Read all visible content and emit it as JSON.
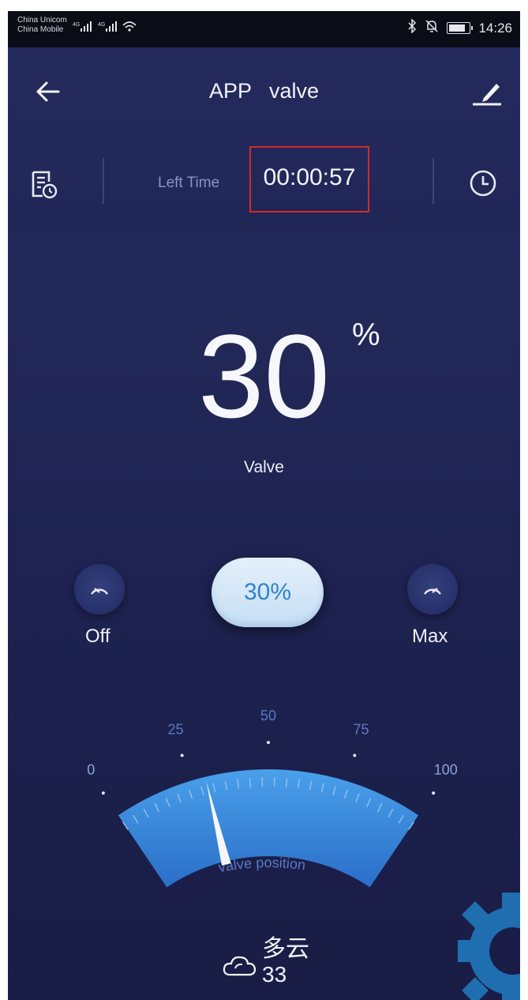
{
  "status_bar": {
    "carrier_1": "China Unicom",
    "carrier_2": "China Mobile",
    "network_1": "4G",
    "network_2": "4G",
    "time": "14:26",
    "battery_level": 0.7
  },
  "app_bar": {
    "title": "APP   valve"
  },
  "timer": {
    "label": "Left Time",
    "value": "00:00:57"
  },
  "valve": {
    "value": "30",
    "unit": "%",
    "label": "Valve",
    "level": 0.3
  },
  "controls": {
    "off_label": "Off",
    "max_label": "Max",
    "current": "30%"
  },
  "gauge": {
    "ticks": [
      "0",
      "25",
      "50",
      "75",
      "100"
    ],
    "caption": "valve position",
    "needle_value": 30,
    "range": [
      0,
      100
    ]
  },
  "weather": {
    "condition": "多云",
    "temperature": "33"
  },
  "colors": {
    "background": "#222858",
    "accent": "#2e84cc",
    "highlight_box": "#d42a2a",
    "gauge_fill": "#3f8fe0"
  }
}
